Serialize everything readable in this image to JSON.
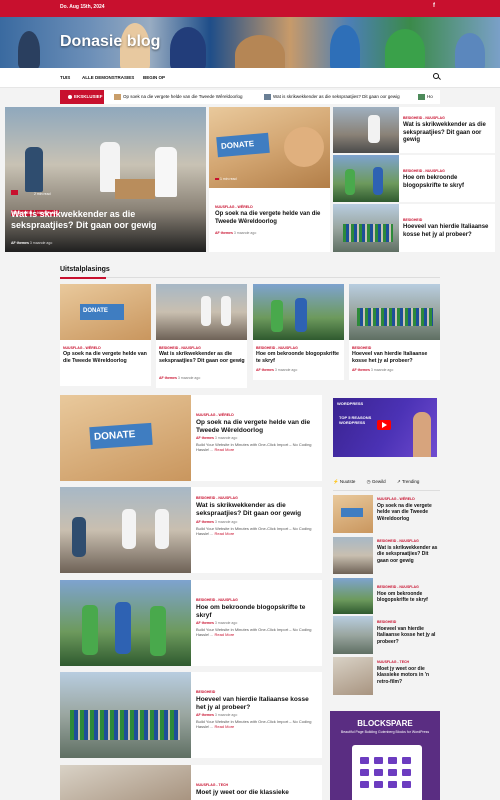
{
  "topbar": {
    "date": "Do. Aug 15th, 2024",
    "social_icon": "facebook-icon",
    "social_glyph": "f"
  },
  "site": {
    "title": "Donasie blog"
  },
  "nav": {
    "items": [
      "TUIS",
      "ALLE DEMONSTRASIES",
      "BEGIN OP"
    ],
    "search_icon": "search-icon"
  },
  "ticker": {
    "label": "EKSKLUSIEF",
    "items": [
      "Op soek na die vergete helde van die Tweede Wêreldoorlog",
      "Wat is skrikwekkender as die sekspraatjies? Dit gaan oor gewig",
      "Ho"
    ]
  },
  "featured": {
    "main": {
      "read_time": "2 min read",
      "categories": [
        "BESIGHEID",
        "NUUSFLAG"
      ],
      "title": "Wat is skrikwekkender as die sekspraatjies? Dit gaan oor gewig",
      "author": "AF themes",
      "time": "3 maande ago"
    },
    "middle": {
      "read_time": "1 min read",
      "categories": "NUUSFLAG - WÊRELD",
      "title": "Op soek na die vergete helde van die Tweede Wêreldoorlog",
      "author": "AF themes",
      "time": "3 maande ago",
      "donate_text": "DONATE"
    },
    "side": [
      {
        "categories": "BESIGHEID - NUUSFLAG",
        "title": "Wat is skrikwekkender as die sekspraatjies? Dit gaan oor gewig"
      },
      {
        "categories": "BESIGHEID - NUUSFLAG",
        "title": "Hoe om bekroonde blogopskrifte te skryf"
      },
      {
        "categories": "BESIGHEID",
        "title": "Hoeveel van hierdie Italiaanse kosse het jy al probeer?"
      }
    ]
  },
  "showcase": {
    "heading": "Uitstalplasings",
    "cards": [
      {
        "categories": "NUUSFLAG - WÊRELD",
        "title": "Op soek na die vergete helde van die Tweede Wêreldoorlog",
        "author": "AF themes",
        "time": "3 maande ago",
        "donate_text": "DONATE"
      },
      {
        "categories": "BESIGHEID - NUUSFLAG",
        "title": "Wat is skrikwekkender as die sekspraatjies? Dit gaan oor gewig",
        "author": "AF themes",
        "time": "3 maande ago"
      },
      {
        "categories": "BESIGHEID - NUUSFLAG",
        "title": "Hoe om bekroonde blogopskrifte te skryf",
        "author": "AF themes",
        "time": "3 maande ago"
      },
      {
        "categories": "BESIGHEID",
        "title": "Hoeveel van hierdie Italiaanse kosse het jy al probeer?",
        "author": "AF themes",
        "time": "3 maande ago"
      }
    ]
  },
  "list": [
    {
      "categories": "NUUSFLAG - WÊRELD",
      "title": "Op soek na die vergete helde van die Tweede Wêreldoorlog",
      "author": "AF themes",
      "time": "3 maande ago",
      "excerpt": "Build Your Website in Minutes with One-Click Import – No Coding Hassle!…",
      "more": "Read More",
      "donate_text": "DONATE"
    },
    {
      "categories": "BESIGHEID - NUUSFLAG",
      "title": "Wat is skrikwekkender as die sekspraatjies? Dit gaan oor gewig",
      "author": "AF themes",
      "time": "3 maande ago",
      "excerpt": "Build Your Website in Minutes with One-Click Import – No Coding Hassle!…",
      "more": "Read More"
    },
    {
      "categories": "BESIGHEID - NUUSFLAG",
      "title": "Hoe om bekroonde blogopskrifte te skryf",
      "author": "AF themes",
      "time": "3 maande ago",
      "excerpt": "Build Your Website in Minutes with One-Click Import – No Coding Hassle!…",
      "more": "Read More"
    },
    {
      "categories": "BESIGHEID",
      "title": "Hoeveel van hierdie Italiaanse kosse het jy al probeer?",
      "author": "AF themes",
      "time": "3 maande ago",
      "excerpt": "Build Your Website in Minutes with One-Click Import – No Coding Hassle!…",
      "more": "Read More"
    },
    {
      "categories": "NUUSFLAG - TECH",
      "title": "Moet jy weet oor die klassieke"
    }
  ],
  "sidebar": {
    "video": {
      "brand": "WORDPRESS",
      "text": "TOP 5 REASONS WORDPRESS"
    },
    "tabs": [
      "Nuutste",
      "Gewild",
      "Trending"
    ],
    "posts": [
      {
        "categories": "NUUSFLAG - WÊRELD",
        "title": "Op soek na die vergete helde van die Tweede Wêreldoorlog"
      },
      {
        "categories": "BESIGHEID - NUUSFLAG",
        "title": "Wat is skrikwekkender as die sekspraatjies? Dit gaan oor gewig"
      },
      {
        "categories": "BESIGHEID - NUUSFLAG",
        "title": "Hoe om bekroonde blogopskrifte te skryf"
      },
      {
        "categories": "BESIGHEID",
        "title": "Hoeveel van hierdie Italiaanse kosse het jy al probeer?"
      },
      {
        "categories": "NUUSFLAG - TECH",
        "title": "Moet jy weet oor die klassieke motors in 'n retro-film?"
      }
    ],
    "banner": {
      "title": "BLOCKSPARE",
      "subtitle": "Beautiful Page Building Gutenberg Blocks for WordPress"
    }
  },
  "colors": {
    "accent": "#c8102e",
    "background": "#f3f3f3"
  }
}
